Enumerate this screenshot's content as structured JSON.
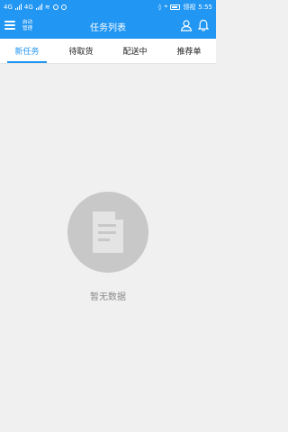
{
  "status_bar": {
    "net_left": "4G",
    "net_right": "4G",
    "carrier": "领视",
    "time": "5:55"
  },
  "app_bar": {
    "sub_line1": "启动",
    "sub_line2": "管理",
    "title": "任务列表"
  },
  "tabs": [
    {
      "label": "新任务",
      "active": true
    },
    {
      "label": "待取货",
      "active": false
    },
    {
      "label": "配送中",
      "active": false
    },
    {
      "label": "推荐单",
      "active": false
    }
  ],
  "empty_state": {
    "text": "暂无数据",
    "icon": "document-icon"
  },
  "colors": {
    "primary": "#2196f3",
    "background": "#f0f0f0",
    "empty_circle": "#c8c8c8",
    "muted_text": "#8a8a8a"
  }
}
